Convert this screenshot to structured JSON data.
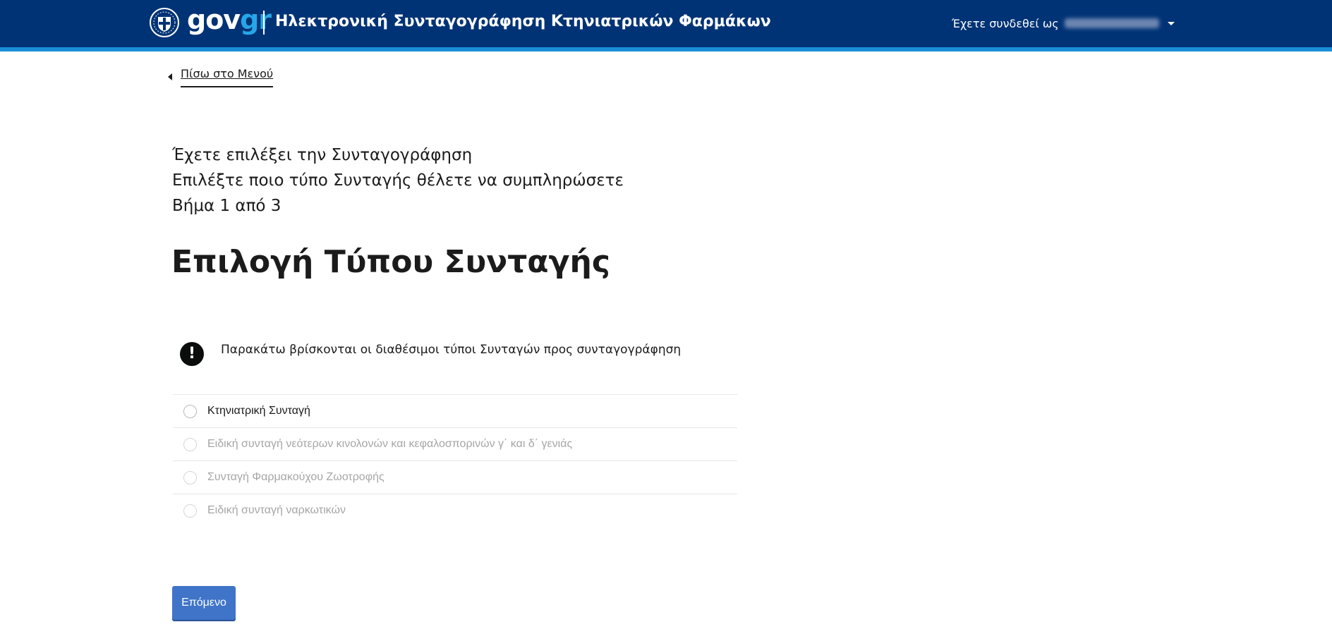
{
  "header": {
    "logo_main": "gov",
    "logo_accent": "gr",
    "title": "Ηλεκτρονική Συνταγογράφηση Κτηνιατρικών Φαρμάκων",
    "login_label": "Έχετε συνδεθεί ως",
    "login_name": "ΕΠΩΝΥΜΟ ΟΝΟΜΑ"
  },
  "nav": {
    "back_label": "Πίσω στο Μενού"
  },
  "intro": {
    "line1": "Έχετε επιλέξει την Συνταγογράφηση",
    "line2": "Επιλέξτε ποιο τύπο Συνταγής θέλετε να συμπληρώσετε",
    "step": "Βήμα 1 από 3"
  },
  "page_title": "Επιλογή Τύπου Συνταγής",
  "notice": {
    "icon": "!",
    "text": "Παρακάτω βρίσκονται οι διαθέσιμοι τύποι Συνταγών προς συνταγογράφηση"
  },
  "prescription_types": [
    {
      "label": "Κτηνιατρική Συνταγή",
      "enabled": true
    },
    {
      "label": "Ειδική συνταγή νεότερων κινολονών και κεφαλοσπορινών γ΄ και δ΄ γενιάς",
      "enabled": false
    },
    {
      "label": "Συνταγή Φαρμακούχου Ζωοτροφής",
      "enabled": false
    },
    {
      "label": "Ειδική συνταγή ναρκωτικών",
      "enabled": false
    }
  ],
  "actions": {
    "next_label": "Επόμενο"
  },
  "colors": {
    "header_bg": "#003375",
    "header_stripe": "#1a8fd6",
    "logo_accent": "#27a6e8",
    "primary_button": "#3f74c8",
    "disabled_text": "#a6a6a6"
  }
}
